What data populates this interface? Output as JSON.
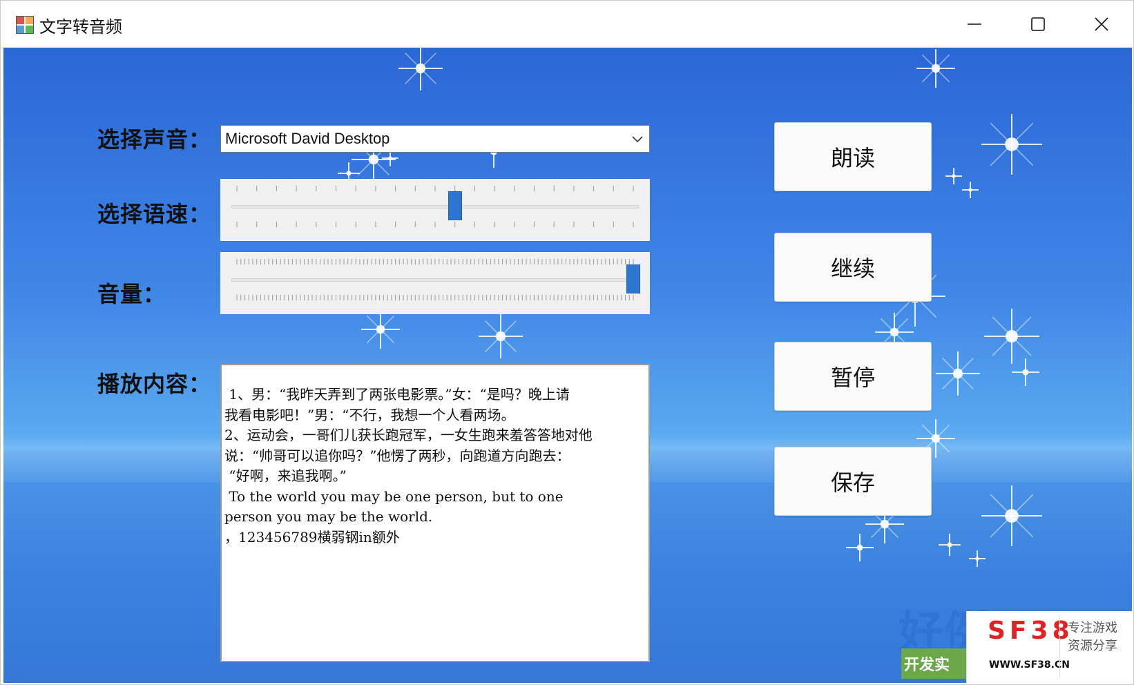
{
  "window": {
    "title": "文字转音频",
    "controls": [
      "minimize-icon",
      "maximize-icon",
      "close-icon"
    ]
  },
  "form": {
    "voice_label": "选择声音：",
    "voice_selected": "Microsoft David Desktop",
    "speed_label": "选择语速：",
    "speed_value_fraction": 0.55,
    "volume_label": "音量：",
    "volume_value_fraction": 1.0,
    "content_label": "播放内容：",
    "content_text": " 1、男：“我昨天弄到了两张电影票。”女：“是吗？晚上请\n我看电影吧！”男：“不行，我想一个人看两场。\n2、运动会，一哥们儿获长跑冠军，一女生跑来羞答答地对他\n说：“帅哥可以追你吗？”他愣了两秒，向跑道方向跑去：\n “好啊，来追我啊。”\n To the world you may be one person, but to one\nperson you may be the world.\n，123456789横弱钢in额外"
  },
  "buttons": {
    "read": "朗读",
    "resume": "继续",
    "pause": "暂停",
    "save": "保存"
  },
  "watermark": {
    "big": "好例子网",
    "green": "开发实",
    "logo": "SF38",
    "url": "WWW.SF38.CN",
    "tag1": "专注游戏",
    "tag2": "资源分享"
  },
  "colors": {
    "accent": "#2e74d1",
    "sky_top": "#2b67d6",
    "sky_bottom": "#3577d8"
  }
}
